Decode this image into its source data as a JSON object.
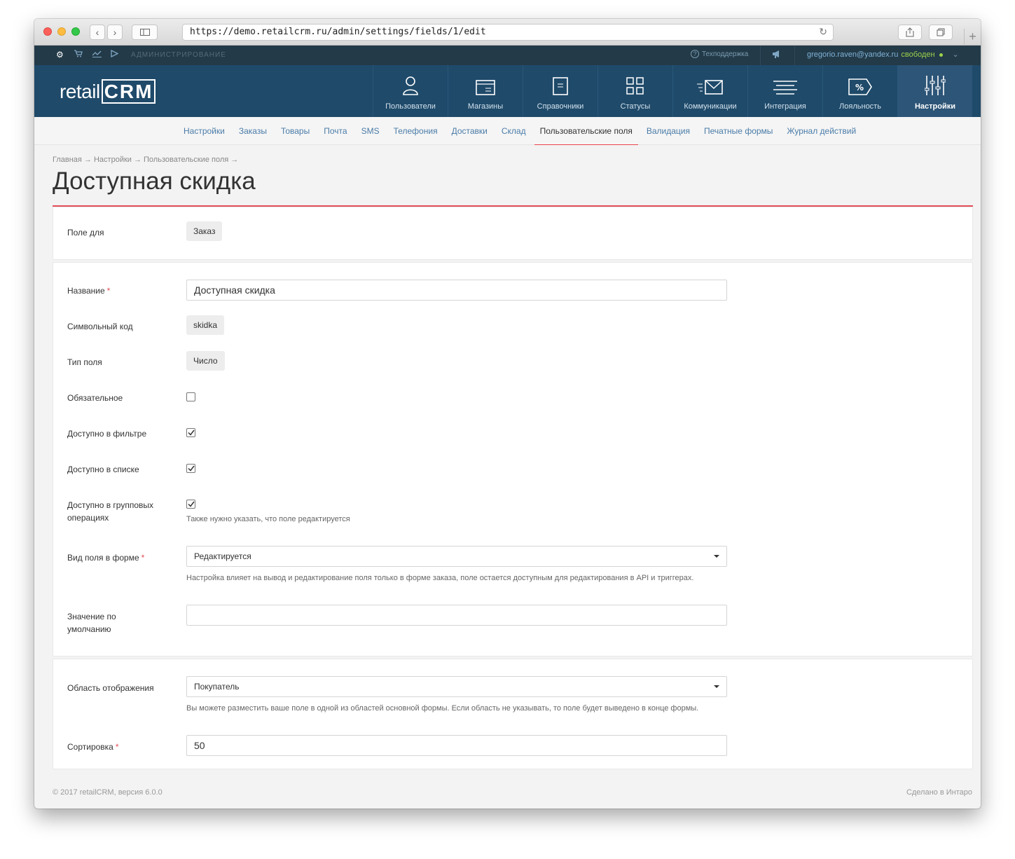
{
  "browser": {
    "url": "https://demo.retailcrm.ru/admin/settings/fields/1/edit"
  },
  "adminbar": {
    "label": "АДМИНИСТРИРОВАНИЕ",
    "support": "Техподдержка",
    "user_email": "gregorio.raven@yandex.ru",
    "user_status": "свободен"
  },
  "logo": {
    "text_a": "retail",
    "text_b": "CRM"
  },
  "mainnav": {
    "items": [
      {
        "label": "Пользователи",
        "icon": "users-icon"
      },
      {
        "label": "Магазины",
        "icon": "shops-icon"
      },
      {
        "label": "Справочники",
        "icon": "dictionaries-icon"
      },
      {
        "label": "Статусы",
        "icon": "statuses-icon"
      },
      {
        "label": "Коммуникации",
        "icon": "communications-icon"
      },
      {
        "label": "Интеграция",
        "icon": "integration-icon"
      },
      {
        "label": "Лояльность",
        "icon": "loyalty-icon"
      },
      {
        "label": "Настройки",
        "icon": "settings-icon",
        "active": true
      }
    ]
  },
  "subnav": {
    "items": [
      "Настройки",
      "Заказы",
      "Товары",
      "Почта",
      "SMS",
      "Телефония",
      "Доставки",
      "Склад",
      "Пользовательские поля",
      "Валидация",
      "Печатные формы",
      "Журнал действий"
    ],
    "active_index": 8
  },
  "breadcrumb": "Главная → Настройки → Пользовательские поля →",
  "page_title": "Доступная скидка",
  "form": {
    "field_for_label": "Поле для",
    "field_for_value": "Заказ",
    "name_label": "Название",
    "name_value": "Доступная скидка",
    "code_label": "Символьный код",
    "code_value": "skidka",
    "type_label": "Тип поля",
    "type_value": "Число",
    "required_label": "Обязательное",
    "required_checked": false,
    "filter_label": "Доступно в фильтре",
    "filter_checked": true,
    "list_label": "Доступно в списке",
    "list_checked": true,
    "group_label_1": "Доступно в групповых",
    "group_label_2": "операциях",
    "group_checked": true,
    "group_hint": "Также нужно указать, что поле редактируется",
    "view_label": "Вид поля в форме",
    "view_value": "Редактируется",
    "view_hint": "Настройка влияет на вывод и редактирование поля только в форме заказа, поле остается доступным для редактирования в API и триггерах.",
    "default_label_1": "Значение по",
    "default_label_2": "умолчанию",
    "default_value": "",
    "area_label": "Область отображения",
    "area_value": "Покупатель",
    "area_hint": "Вы можете разместить ваше поле в одной из областей основной формы. Если область не указывать, то поле будет выведено в конце формы.",
    "sort_label": "Сортировка",
    "sort_value": "50",
    "required_mark": "*"
  },
  "footer": {
    "left": "© 2017 retailCRM, версия 6.0.0",
    "right": "Сделано в Интаро"
  }
}
